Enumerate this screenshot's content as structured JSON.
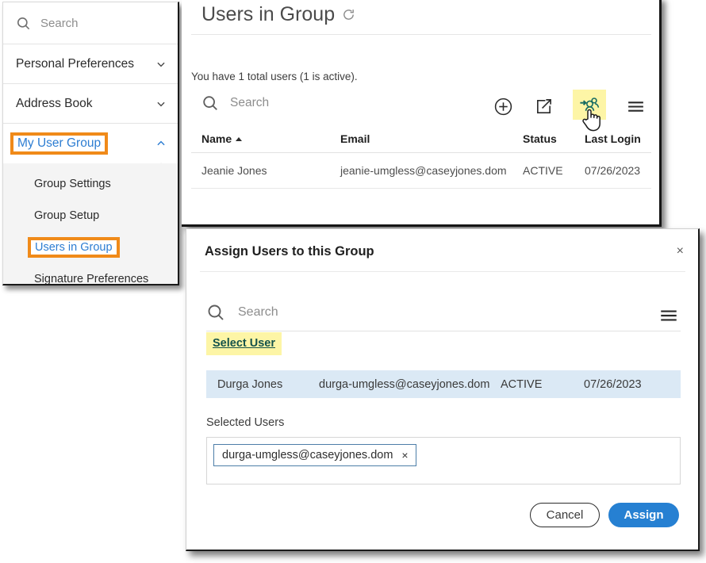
{
  "sidebar": {
    "search": {
      "placeholder": "Search",
      "icon": "search-icon"
    },
    "items": [
      {
        "label": "Personal Preferences",
        "icon": "chevron-down-icon"
      },
      {
        "label": "Address Book",
        "icon": "chevron-down-icon"
      },
      {
        "label": "My User Group",
        "icon": "chevron-up-icon"
      }
    ],
    "subitems": [
      {
        "label": "Group Settings"
      },
      {
        "label": "Group Setup"
      },
      {
        "label": "Users in Group"
      },
      {
        "label": "Signature Preferences"
      }
    ]
  },
  "main": {
    "title": "Users in Group",
    "refresh_icon": "refresh-icon",
    "summary": "You have 1 total users (1 is active).",
    "search": {
      "placeholder": "Search",
      "icon": "search-icon"
    },
    "tools": [
      {
        "name": "add-icon",
        "label": "+"
      },
      {
        "name": "export-icon",
        "label": ""
      },
      {
        "name": "assign-users-icon",
        "label": ""
      },
      {
        "name": "menu-icon",
        "label": ""
      }
    ],
    "table": {
      "columns": [
        "Name",
        "Email",
        "Status",
        "Last Login"
      ],
      "sort_column": "Name",
      "sort_direction": "asc",
      "rows": [
        {
          "name": "Jeanie Jones",
          "email": "jeanie-umgless@caseyjones.dom",
          "status": "ACTIVE",
          "last_login": "07/26/2023"
        }
      ]
    }
  },
  "dialog": {
    "title": "Assign Users to this Group",
    "close_label": "×",
    "search": {
      "placeholder": "Search",
      "icon": "search-icon"
    },
    "menu_icon": "menu-icon",
    "select_user_link": "Select User",
    "result_row": {
      "name": "Durga Jones",
      "email": "durga-umgless@caseyjones.dom",
      "status": "ACTIVE",
      "last_login": "07/26/2023"
    },
    "selected_users_label": "Selected Users",
    "chips": [
      {
        "text": "durga-umgless@caseyjones.dom",
        "remove_label": "×"
      }
    ],
    "buttons": {
      "cancel": "Cancel",
      "assign": "Assign"
    }
  },
  "colors": {
    "highlight_box": "#f08a19",
    "highlight_fill": "#fdf5a6",
    "link": "#2d7dd2",
    "primary_button": "#2680d2",
    "row_selected": "#dbe9f5",
    "select_user_link": "#14524b"
  }
}
